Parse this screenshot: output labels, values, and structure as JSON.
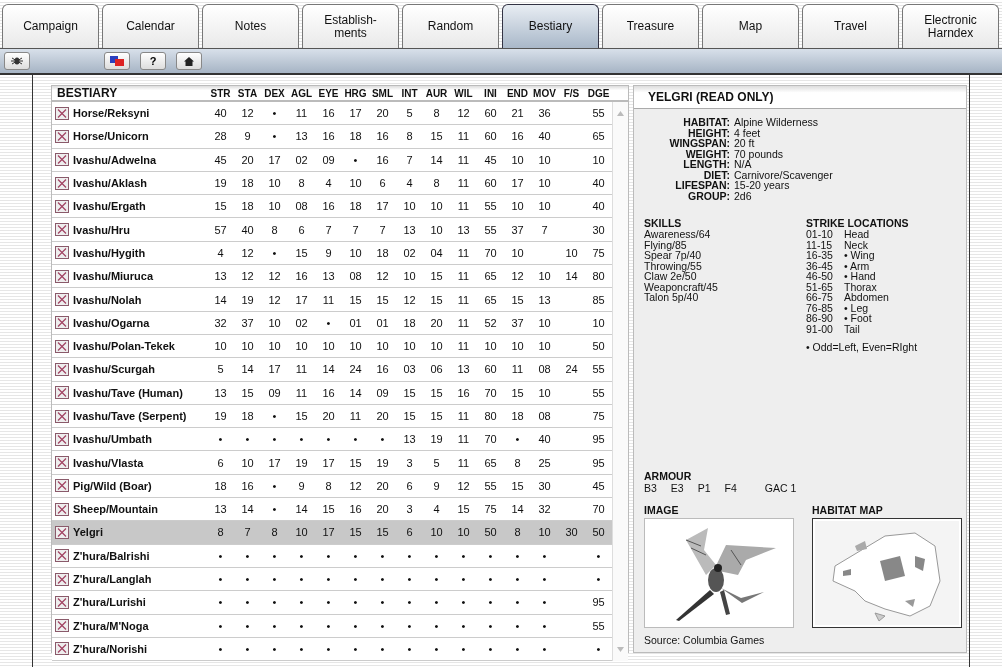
{
  "tabs": [
    {
      "label": "Campaign",
      "selected": false
    },
    {
      "label": "Calendar",
      "selected": false
    },
    {
      "label": "Notes",
      "selected": false
    },
    {
      "label": "Establish-\nments",
      "selected": false
    },
    {
      "label": "Random",
      "selected": false
    },
    {
      "label": "Bestiary",
      "selected": true
    },
    {
      "label": "Treasure",
      "selected": false
    },
    {
      "label": "Map",
      "selected": false
    },
    {
      "label": "Travel",
      "selected": false
    },
    {
      "label": "Electronic Harndex",
      "selected": false
    }
  ],
  "toolbar": {
    "buttons": [
      {
        "kind": "bug"
      },
      {
        "kind": "flags"
      },
      {
        "kind": "help",
        "label": "?"
      },
      {
        "kind": "home"
      }
    ]
  },
  "bestiary": {
    "title": "BESTIARY",
    "columns": [
      "STR",
      "STA",
      "DEX",
      "AGL",
      "EYE",
      "HRG",
      "SML",
      "INT",
      "AUR",
      "WIL",
      "INI",
      "END",
      "MOV",
      "F/S",
      "DGE"
    ],
    "rows": [
      {
        "name": "Horse/Reksyni",
        "selected": false,
        "stats": {
          "STR": "40",
          "STA": "12",
          "DEX": "•",
          "AGL": "11",
          "EYE": "16",
          "HRG": "17",
          "SML": "20",
          "INT": "5",
          "AUR": "8",
          "WIL": "12",
          "INI": "60",
          "END": "21",
          "MOV": "36",
          "DGE": "55"
        }
      },
      {
        "name": "Horse/Unicorn",
        "selected": false,
        "stats": {
          "STR": "28",
          "STA": "9",
          "DEX": "•",
          "AGL": "13",
          "EYE": "16",
          "HRG": "18",
          "SML": "16",
          "INT": "8",
          "AUR": "15",
          "WIL": "11",
          "INI": "60",
          "END": "16",
          "MOV": "40",
          "DGE": "65"
        }
      },
      {
        "name": "Ivashu/Adwelna",
        "selected": false,
        "stats": {
          "STR": "45",
          "STA": "20",
          "DEX": "17",
          "AGL": "02",
          "EYE": "09",
          "HRG": "•",
          "SML": "16",
          "INT": "7",
          "AUR": "14",
          "WIL": "11",
          "INI": "45",
          "END": "10",
          "MOV": "10",
          "DGE": "10"
        }
      },
      {
        "name": "Ivashu/Aklash",
        "selected": false,
        "stats": {
          "STR": "19",
          "STA": "18",
          "DEX": "10",
          "AGL": "8",
          "EYE": "4",
          "HRG": "10",
          "SML": "6",
          "INT": "4",
          "AUR": "8",
          "WIL": "11",
          "INI": "60",
          "END": "17",
          "MOV": "10",
          "DGE": "40"
        }
      },
      {
        "name": "Ivashu/Ergath",
        "selected": false,
        "stats": {
          "STR": "15",
          "STA": "18",
          "DEX": "10",
          "AGL": "08",
          "EYE": "16",
          "HRG": "18",
          "SML": "17",
          "INT": "10",
          "AUR": "10",
          "WIL": "11",
          "INI": "55",
          "END": "10",
          "MOV": "10",
          "DGE": "40"
        }
      },
      {
        "name": "Ivashu/Hru",
        "selected": false,
        "stats": {
          "STR": "57",
          "STA": "40",
          "DEX": "8",
          "AGL": "6",
          "EYE": "7",
          "HRG": "7",
          "SML": "7",
          "INT": "13",
          "AUR": "10",
          "WIL": "13",
          "INI": "55",
          "END": "37",
          "MOV": "7",
          "DGE": "30"
        }
      },
      {
        "name": "Ivashu/Hygith",
        "selected": false,
        "stats": {
          "STR": "4",
          "STA": "12",
          "DEX": "•",
          "AGL": "15",
          "EYE": "9",
          "HRG": "10",
          "SML": "18",
          "INT": "02",
          "AUR": "04",
          "WIL": "11",
          "INI": "70",
          "END": "10",
          "F/S": "10",
          "DGE": "75"
        }
      },
      {
        "name": "Ivashu/Miuruca",
        "selected": false,
        "stats": {
          "STR": "13",
          "STA": "12",
          "DEX": "12",
          "AGL": "16",
          "EYE": "13",
          "HRG": "08",
          "SML": "12",
          "INT": "10",
          "AUR": "15",
          "WIL": "11",
          "INI": "65",
          "END": "12",
          "MOV": "10",
          "F/S": "14",
          "DGE": "80"
        }
      },
      {
        "name": "Ivashu/Nolah",
        "selected": false,
        "stats": {
          "STR": "14",
          "STA": "19",
          "DEX": "12",
          "AGL": "17",
          "EYE": "11",
          "HRG": "15",
          "SML": "15",
          "INT": "12",
          "AUR": "15",
          "WIL": "11",
          "INI": "65",
          "END": "15",
          "MOV": "13",
          "DGE": "85"
        }
      },
      {
        "name": "Ivashu/Ogarna",
        "selected": false,
        "stats": {
          "STR": "32",
          "STA": "37",
          "DEX": "10",
          "AGL": "02",
          "EYE": "•",
          "HRG": "01",
          "SML": "01",
          "INT": "18",
          "AUR": "20",
          "WIL": "11",
          "INI": "52",
          "END": "37",
          "MOV": "10",
          "DGE": "10"
        }
      },
      {
        "name": "Ivashu/Polan-Tekek",
        "selected": false,
        "stats": {
          "STR": "10",
          "STA": "10",
          "DEX": "10",
          "AGL": "10",
          "EYE": "10",
          "HRG": "10",
          "SML": "10",
          "INT": "10",
          "AUR": "10",
          "WIL": "11",
          "INI": "10",
          "END": "10",
          "MOV": "10",
          "DGE": "50"
        }
      },
      {
        "name": "Ivashu/Scurgah",
        "selected": false,
        "stats": {
          "STR": "5",
          "STA": "14",
          "DEX": "17",
          "AGL": "11",
          "EYE": "14",
          "HRG": "24",
          "SML": "16",
          "INT": "03",
          "AUR": "06",
          "WIL": "13",
          "INI": "60",
          "END": "11",
          "MOV": "08",
          "F/S": "24",
          "DGE": "55"
        }
      },
      {
        "name": "Ivashu/Tave (Human)",
        "selected": false,
        "stats": {
          "STR": "13",
          "STA": "15",
          "DEX": "09",
          "AGL": "11",
          "EYE": "16",
          "HRG": "14",
          "SML": "09",
          "INT": "15",
          "AUR": "15",
          "WIL": "16",
          "INI": "70",
          "END": "15",
          "MOV": "10",
          "DGE": "55"
        }
      },
      {
        "name": "Ivashu/Tave (Serpent)",
        "selected": false,
        "stats": {
          "STR": "19",
          "STA": "18",
          "DEX": "•",
          "AGL": "15",
          "EYE": "20",
          "HRG": "11",
          "SML": "20",
          "INT": "15",
          "AUR": "15",
          "WIL": "11",
          "INI": "80",
          "END": "18",
          "MOV": "08",
          "DGE": "75"
        }
      },
      {
        "name": "Ivashu/Umbath",
        "selected": false,
        "stats": {
          "STR": "•",
          "STA": "•",
          "DEX": "•",
          "AGL": "•",
          "EYE": "•",
          "HRG": "•",
          "SML": "•",
          "INT": "13",
          "AUR": "19",
          "WIL": "11",
          "INI": "70",
          "END": "•",
          "MOV": "40",
          "DGE": "95"
        }
      },
      {
        "name": "Ivashu/Vlasta",
        "selected": false,
        "stats": {
          "STR": "6",
          "STA": "10",
          "DEX": "17",
          "AGL": "19",
          "EYE": "17",
          "HRG": "15",
          "SML": "19",
          "INT": "3",
          "AUR": "5",
          "WIL": "11",
          "INI": "65",
          "END": "8",
          "MOV": "25",
          "DGE": "95"
        }
      },
      {
        "name": "Pig/Wild (Boar)",
        "selected": false,
        "stats": {
          "STR": "18",
          "STA": "16",
          "DEX": "•",
          "AGL": "9",
          "EYE": "8",
          "HRG": "12",
          "SML": "20",
          "INT": "6",
          "AUR": "9",
          "WIL": "12",
          "INI": "55",
          "END": "15",
          "MOV": "30",
          "DGE": "45"
        }
      },
      {
        "name": "Sheep/Mountain",
        "selected": false,
        "stats": {
          "STR": "13",
          "STA": "14",
          "DEX": "•",
          "AGL": "14",
          "EYE": "15",
          "HRG": "16",
          "SML": "20",
          "INT": "3",
          "AUR": "4",
          "WIL": "15",
          "INI": "75",
          "END": "14",
          "MOV": "32",
          "DGE": "70"
        }
      },
      {
        "name": "Yelgri",
        "selected": true,
        "stats": {
          "STR": "8",
          "STA": "7",
          "DEX": "8",
          "AGL": "10",
          "EYE": "17",
          "HRG": "15",
          "SML": "15",
          "INT": "6",
          "AUR": "10",
          "WIL": "10",
          "INI": "50",
          "END": "8",
          "MOV": "10",
          "F/S": "30",
          "DGE": "50"
        }
      },
      {
        "name": "Z'hura/Balrishi",
        "selected": false,
        "stats": {
          "STR": "•",
          "STA": "•",
          "DEX": "•",
          "AGL": "•",
          "EYE": "•",
          "HRG": "•",
          "SML": "•",
          "INT": "•",
          "AUR": "•",
          "WIL": "•",
          "INI": "•",
          "END": "•",
          "MOV": "•",
          "DGE": "•"
        }
      },
      {
        "name": "Z'hura/Langlah",
        "selected": false,
        "stats": {
          "STR": "•",
          "STA": "•",
          "DEX": "•",
          "AGL": "•",
          "EYE": "•",
          "HRG": "•",
          "SML": "•",
          "INT": "•",
          "AUR": "•",
          "WIL": "•",
          "INI": "•",
          "END": "•",
          "MOV": "•",
          "DGE": "•"
        }
      },
      {
        "name": "Z'hura/Lurishi",
        "selected": false,
        "stats": {
          "STR": "•",
          "STA": "•",
          "DEX": "•",
          "AGL": "•",
          "EYE": "•",
          "HRG": "•",
          "SML": "•",
          "INT": "•",
          "AUR": "•",
          "WIL": "•",
          "INI": "•",
          "END": "•",
          "MOV": "•",
          "DGE": "95"
        }
      },
      {
        "name": "Z'hura/M'Noga",
        "selected": false,
        "stats": {
          "STR": "•",
          "STA": "•",
          "DEX": "•",
          "AGL": "•",
          "EYE": "•",
          "HRG": "•",
          "SML": "•",
          "INT": "•",
          "AUR": "•",
          "WIL": "•",
          "INI": "•",
          "END": "•",
          "MOV": "•",
          "DGE": "55"
        }
      },
      {
        "name": "Z'hura/Norishi",
        "selected": false,
        "stats": {
          "STR": "•",
          "STA": "•",
          "DEX": "•",
          "AGL": "•",
          "EYE": "•",
          "HRG": "•",
          "SML": "•",
          "INT": "•",
          "AUR": "•",
          "WIL": "•",
          "INI": "•",
          "END": "•",
          "MOV": "•",
          "DGE": "•"
        }
      }
    ]
  },
  "detail": {
    "title": "YELGRI (READ ONLY)",
    "attributes": [
      {
        "label": "HABITAT:",
        "value": "Alpine Wilderness"
      },
      {
        "label": "HEIGHT:",
        "value": "4 feet"
      },
      {
        "label": "WINGSPAN:",
        "value": "20 ft"
      },
      {
        "label": "WEIGHT:",
        "value": "70 pounds"
      },
      {
        "label": "LENGTH:",
        "value": "N/A"
      },
      {
        "label": "DIET:",
        "value": "Carnivore/Scavenger"
      },
      {
        "label": "LIFESPAN:",
        "value": "15-20 years"
      },
      {
        "label": "GROUP:",
        "value": "2d6"
      }
    ],
    "skills": {
      "title": "SKILLS",
      "items": [
        "Awareness/64",
        "Flying/85",
        "Spear 7p/40",
        "Throwing/55",
        "Claw 2e/50",
        "Weaponcraft/45",
        "Talon 5p/40"
      ]
    },
    "strike_locations": {
      "title": "STRIKE LOCATIONS",
      "items": [
        {
          "range": "01-10",
          "location": "Head"
        },
        {
          "range": "11-15",
          "location": "Neck"
        },
        {
          "range": "16-35",
          "location": "• Wing"
        },
        {
          "range": "36-45",
          "location": "• Arm"
        },
        {
          "range": "46-50",
          "location": "• Hand"
        },
        {
          "range": "51-65",
          "location": "Thorax"
        },
        {
          "range": "66-75",
          "location": "Abdomen"
        },
        {
          "range": "76-85",
          "location": "• Leg"
        },
        {
          "range": "86-90",
          "location": "• Foot"
        },
        {
          "range": "91-00",
          "location": "Tail"
        }
      ],
      "note": "• Odd=Left, Even=RIght"
    },
    "armour": {
      "title": "ARMOUR",
      "values": [
        "B3",
        "E3",
        "P1",
        "F4",
        "GAC 1"
      ]
    },
    "image": {
      "title": "IMAGE",
      "kind": "picture"
    },
    "habitat_map": {
      "title": "HABITAT MAP",
      "kind": "picture"
    },
    "source": "Source: Columbia Games"
  }
}
